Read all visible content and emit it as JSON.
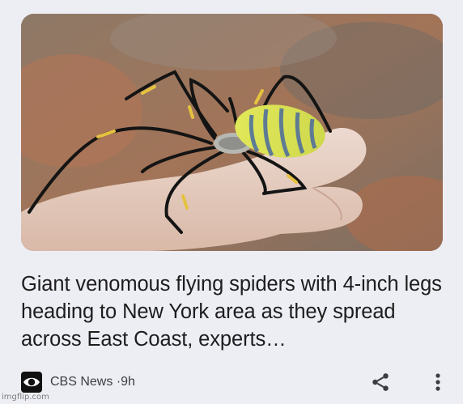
{
  "article": {
    "headline": "Giant venomous flying spiders with 4-inch legs heading to New York area as they spread across East Coast, experts…",
    "image_icon": "photo-spider-on-hand"
  },
  "source": {
    "name": "CBS News",
    "separator": "·",
    "age": "9h",
    "logo_icon": "cbs-eye-logo-icon"
  },
  "actions": {
    "share_icon": "share-icon",
    "more_icon": "more-vertical-icon"
  },
  "watermark": "imgflip.com"
}
